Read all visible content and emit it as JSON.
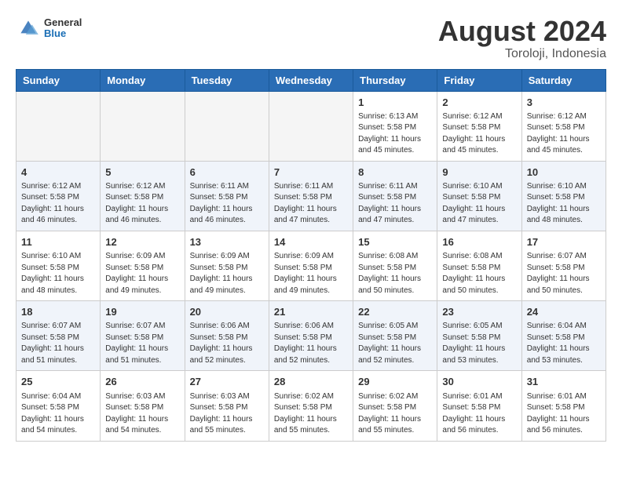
{
  "header": {
    "logo": {
      "general": "General",
      "blue": "Blue"
    },
    "month_year": "August 2024",
    "location": "Toroloji, Indonesia"
  },
  "days_of_week": [
    "Sunday",
    "Monday",
    "Tuesday",
    "Wednesday",
    "Thursday",
    "Friday",
    "Saturday"
  ],
  "weeks": [
    [
      {
        "day": "",
        "empty": true
      },
      {
        "day": "",
        "empty": true
      },
      {
        "day": "",
        "empty": true
      },
      {
        "day": "",
        "empty": true
      },
      {
        "day": "1",
        "sunrise": "6:13 AM",
        "sunset": "5:58 PM",
        "daylight": "11 hours and 45 minutes."
      },
      {
        "day": "2",
        "sunrise": "6:12 AM",
        "sunset": "5:58 PM",
        "daylight": "11 hours and 45 minutes."
      },
      {
        "day": "3",
        "sunrise": "6:12 AM",
        "sunset": "5:58 PM",
        "daylight": "11 hours and 45 minutes."
      }
    ],
    [
      {
        "day": "4",
        "sunrise": "6:12 AM",
        "sunset": "5:58 PM",
        "daylight": "11 hours and 46 minutes."
      },
      {
        "day": "5",
        "sunrise": "6:12 AM",
        "sunset": "5:58 PM",
        "daylight": "11 hours and 46 minutes."
      },
      {
        "day": "6",
        "sunrise": "6:11 AM",
        "sunset": "5:58 PM",
        "daylight": "11 hours and 46 minutes."
      },
      {
        "day": "7",
        "sunrise": "6:11 AM",
        "sunset": "5:58 PM",
        "daylight": "11 hours and 47 minutes."
      },
      {
        "day": "8",
        "sunrise": "6:11 AM",
        "sunset": "5:58 PM",
        "daylight": "11 hours and 47 minutes."
      },
      {
        "day": "9",
        "sunrise": "6:10 AM",
        "sunset": "5:58 PM",
        "daylight": "11 hours and 47 minutes."
      },
      {
        "day": "10",
        "sunrise": "6:10 AM",
        "sunset": "5:58 PM",
        "daylight": "11 hours and 48 minutes."
      }
    ],
    [
      {
        "day": "11",
        "sunrise": "6:10 AM",
        "sunset": "5:58 PM",
        "daylight": "11 hours and 48 minutes."
      },
      {
        "day": "12",
        "sunrise": "6:09 AM",
        "sunset": "5:58 PM",
        "daylight": "11 hours and 49 minutes."
      },
      {
        "day": "13",
        "sunrise": "6:09 AM",
        "sunset": "5:58 PM",
        "daylight": "11 hours and 49 minutes."
      },
      {
        "day": "14",
        "sunrise": "6:09 AM",
        "sunset": "5:58 PM",
        "daylight": "11 hours and 49 minutes."
      },
      {
        "day": "15",
        "sunrise": "6:08 AM",
        "sunset": "5:58 PM",
        "daylight": "11 hours and 50 minutes."
      },
      {
        "day": "16",
        "sunrise": "6:08 AM",
        "sunset": "5:58 PM",
        "daylight": "11 hours and 50 minutes."
      },
      {
        "day": "17",
        "sunrise": "6:07 AM",
        "sunset": "5:58 PM",
        "daylight": "11 hours and 50 minutes."
      }
    ],
    [
      {
        "day": "18",
        "sunrise": "6:07 AM",
        "sunset": "5:58 PM",
        "daylight": "11 hours and 51 minutes."
      },
      {
        "day": "19",
        "sunrise": "6:07 AM",
        "sunset": "5:58 PM",
        "daylight": "11 hours and 51 minutes."
      },
      {
        "day": "20",
        "sunrise": "6:06 AM",
        "sunset": "5:58 PM",
        "daylight": "11 hours and 52 minutes."
      },
      {
        "day": "21",
        "sunrise": "6:06 AM",
        "sunset": "5:58 PM",
        "daylight": "11 hours and 52 minutes."
      },
      {
        "day": "22",
        "sunrise": "6:05 AM",
        "sunset": "5:58 PM",
        "daylight": "11 hours and 52 minutes."
      },
      {
        "day": "23",
        "sunrise": "6:05 AM",
        "sunset": "5:58 PM",
        "daylight": "11 hours and 53 minutes."
      },
      {
        "day": "24",
        "sunrise": "6:04 AM",
        "sunset": "5:58 PM",
        "daylight": "11 hours and 53 minutes."
      }
    ],
    [
      {
        "day": "25",
        "sunrise": "6:04 AM",
        "sunset": "5:58 PM",
        "daylight": "11 hours and 54 minutes."
      },
      {
        "day": "26",
        "sunrise": "6:03 AM",
        "sunset": "5:58 PM",
        "daylight": "11 hours and 54 minutes."
      },
      {
        "day": "27",
        "sunrise": "6:03 AM",
        "sunset": "5:58 PM",
        "daylight": "11 hours and 55 minutes."
      },
      {
        "day": "28",
        "sunrise": "6:02 AM",
        "sunset": "5:58 PM",
        "daylight": "11 hours and 55 minutes."
      },
      {
        "day": "29",
        "sunrise": "6:02 AM",
        "sunset": "5:58 PM",
        "daylight": "11 hours and 55 minutes."
      },
      {
        "day": "30",
        "sunrise": "6:01 AM",
        "sunset": "5:58 PM",
        "daylight": "11 hours and 56 minutes."
      },
      {
        "day": "31",
        "sunrise": "6:01 AM",
        "sunset": "5:58 PM",
        "daylight": "11 hours and 56 minutes."
      }
    ]
  ],
  "labels": {
    "sunrise": "Sunrise:",
    "sunset": "Sunset:",
    "daylight": "Daylight:"
  }
}
